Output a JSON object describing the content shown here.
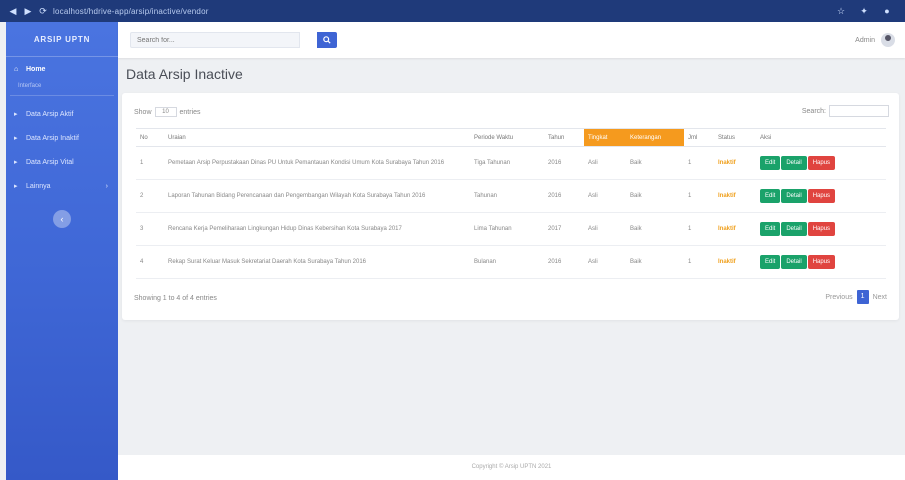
{
  "topbar": {
    "url_text": "localhost/hdrive-app/arsip/inactive/vendor"
  },
  "sidebar": {
    "brand": "ARSIP UPTN",
    "dashboard": "Home",
    "heading": "Interface",
    "items": [
      {
        "label": "Data Arsip Aktif"
      },
      {
        "label": "Data Arsip Inaktif"
      },
      {
        "label": "Data Arsip Vital"
      },
      {
        "label": "Lainnya"
      }
    ]
  },
  "header": {
    "search_placeholder": "Search for...",
    "user_name": "Admin"
  },
  "page": {
    "title": "Data Arsip Inactive"
  },
  "datatable": {
    "show_label": "Show",
    "length_value": "10",
    "entries_label": "entries",
    "search_label": "Search:",
    "columns": [
      "No",
      "Uraian",
      "Periode Waktu",
      "Tahun",
      "Tingkat",
      "Keterangan",
      "Jml",
      "Status",
      "Aksi"
    ],
    "rows": [
      {
        "no": "1",
        "uraian": "Pemetaan Arsip Perpustakaan Dinas PU Untuk Pemantauan Kondisi Umum Kota Surabaya Tahun 2016",
        "periode": "Tiga Tahunan",
        "tahun": "2016",
        "tingkat": "Asli",
        "ket": "Baik",
        "jml": "1",
        "status": "Inaktif"
      },
      {
        "no": "2",
        "uraian": "Laporan Tahunan Bidang Perencanaan dan Pengembangan Wilayah Kota Surabaya Tahun 2016",
        "periode": "Tahunan",
        "tahun": "2016",
        "tingkat": "Asli",
        "ket": "Baik",
        "jml": "1",
        "status": "Inaktif"
      },
      {
        "no": "3",
        "uraian": "Rencana Kerja Pemeliharaan Lingkungan Hidup Dinas Kebersihan Kota Surabaya 2017",
        "periode": "Lima Tahunan",
        "tahun": "2017",
        "tingkat": "Asli",
        "ket": "Baik",
        "jml": "1",
        "status": "Inaktif"
      },
      {
        "no": "4",
        "uraian": "Rekap Surat Keluar Masuk Sekretariat Daerah Kota Surabaya Tahun 2016",
        "periode": "Bulanan",
        "tahun": "2016",
        "tingkat": "Asli",
        "ket": "Baik",
        "jml": "1",
        "status": "Inaktif"
      }
    ],
    "btn_edit": "Edit",
    "btn_detail": "Detail",
    "btn_delete": "Hapus",
    "info": "Showing 1 to 4 of 4 entries",
    "prev": "Previous",
    "page": "1",
    "next": "Next"
  },
  "footer": {
    "text": "Copyright © Arsip UPTN 2021"
  }
}
